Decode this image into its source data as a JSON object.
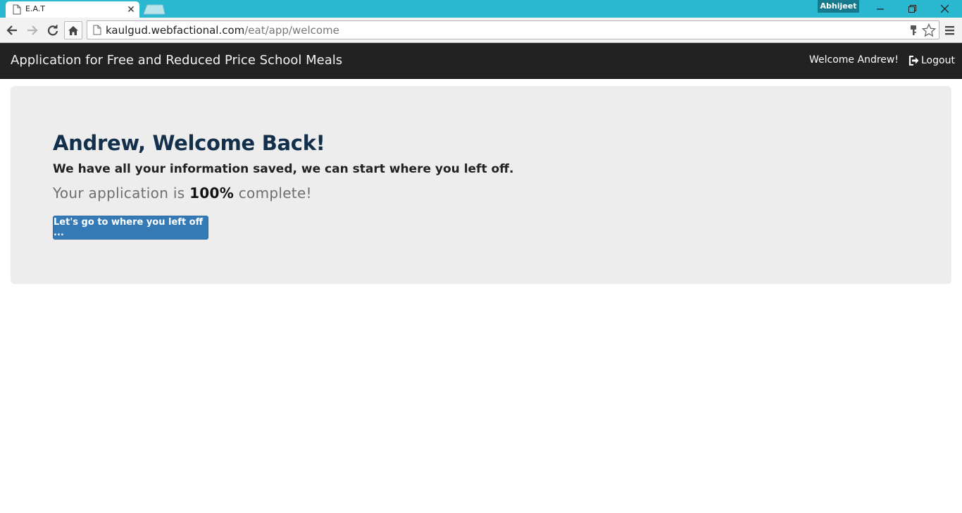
{
  "browser": {
    "tab_title": "E.A.T",
    "profile_name": "Abhijeet",
    "url_host": "kaulgud.webfactional.com",
    "url_path": "/eat/app/welcome"
  },
  "navbar": {
    "brand": "Application for Free and Reduced Price School Meals",
    "welcome": "Welcome Andrew!",
    "logout_label": "Logout"
  },
  "welcome": {
    "title": "Andrew, Welcome Back!",
    "subtitle": "We have all your information saved, we can start where you left off.",
    "progress_prefix": "Your application is ",
    "progress_percent": "100%",
    "progress_suffix": " complete!",
    "button_label": "Let's go to where you left off ..."
  },
  "colors": {
    "titlebar": "#2ab7d0",
    "navbar": "#222222",
    "jumbotron": "#ededed",
    "title_text": "#12304c",
    "primary_button": "#337ab7"
  }
}
